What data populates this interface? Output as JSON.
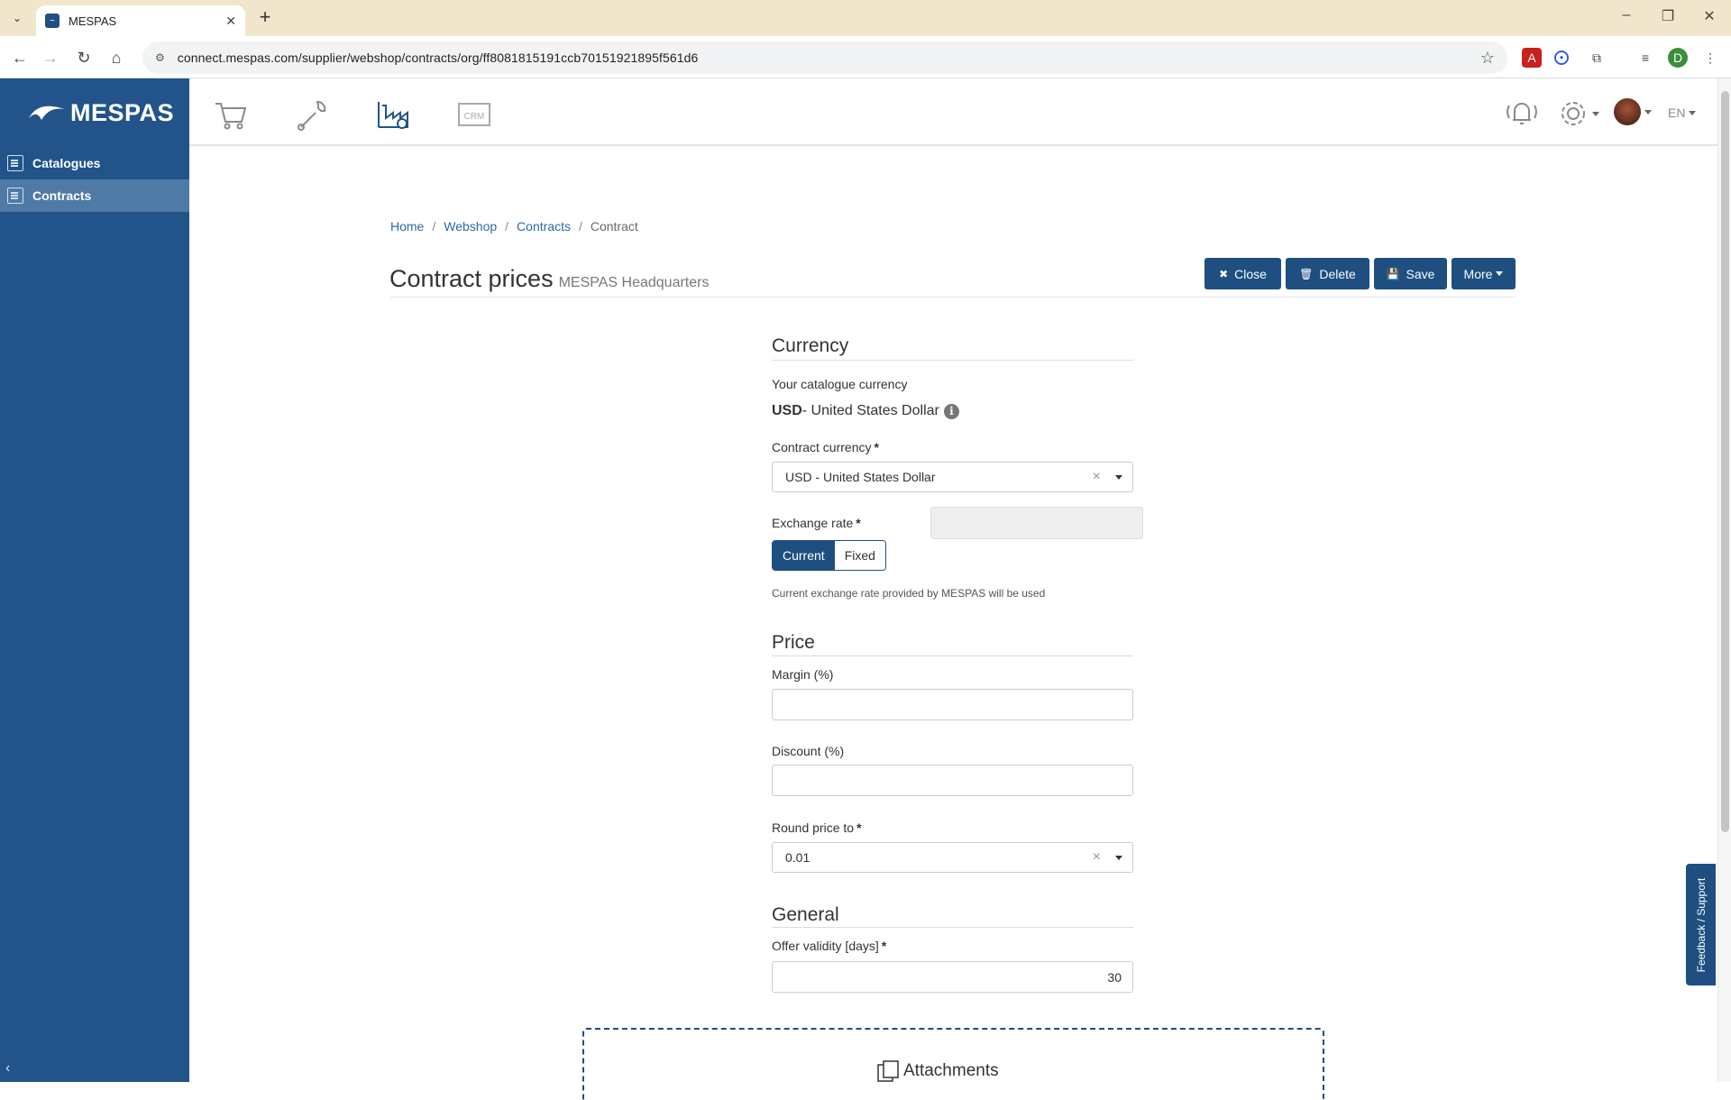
{
  "browser": {
    "tab_title": "MESPAS",
    "url": "connect.mespas.com/supplier/webshop/contracts/org/ff8081815191ccb70151921895f561d6",
    "profile_initial": "D"
  },
  "app": {
    "logo_text": "MESPAS",
    "lang": "EN"
  },
  "sidebar": {
    "items": [
      {
        "label": "Catalogues"
      },
      {
        "label": "Contracts"
      }
    ]
  },
  "breadcrumb": {
    "items": [
      "Home",
      "Webshop",
      "Contracts",
      "Contract"
    ]
  },
  "page": {
    "title": "Contract prices",
    "subtitle": "MESPAS Headquarters"
  },
  "actions": {
    "close": "Close",
    "delete": "Delete",
    "save": "Save",
    "more": "More"
  },
  "currency": {
    "section_title": "Currency",
    "catalogue_label": "Your catalogue currency",
    "catalogue_code": "USD",
    "catalogue_name": " - United States Dollar",
    "contract_label": "Contract currency",
    "contract_value": "USD - United States Dollar",
    "exchange_label": "Exchange rate",
    "exchange_value": "",
    "toggle_current": "Current",
    "toggle_fixed": "Fixed",
    "help": "Current exchange rate provided by MESPAS will be used"
  },
  "price": {
    "section_title": "Price",
    "margin_label": "Margin (%)",
    "margin_value": "",
    "discount_label": "Discount (%)",
    "discount_value": "",
    "round_label": "Round price to",
    "round_value": "0.01"
  },
  "general": {
    "section_title": "General",
    "validity_label": "Offer validity [days]",
    "validity_value": "30"
  },
  "attachments": {
    "label": "Attachments"
  },
  "feedback": {
    "label": "Feedback / Support"
  },
  "colors": {
    "brand": "#22548a",
    "button": "#1e4f80",
    "sidebar_active": "#4f7aa6"
  }
}
